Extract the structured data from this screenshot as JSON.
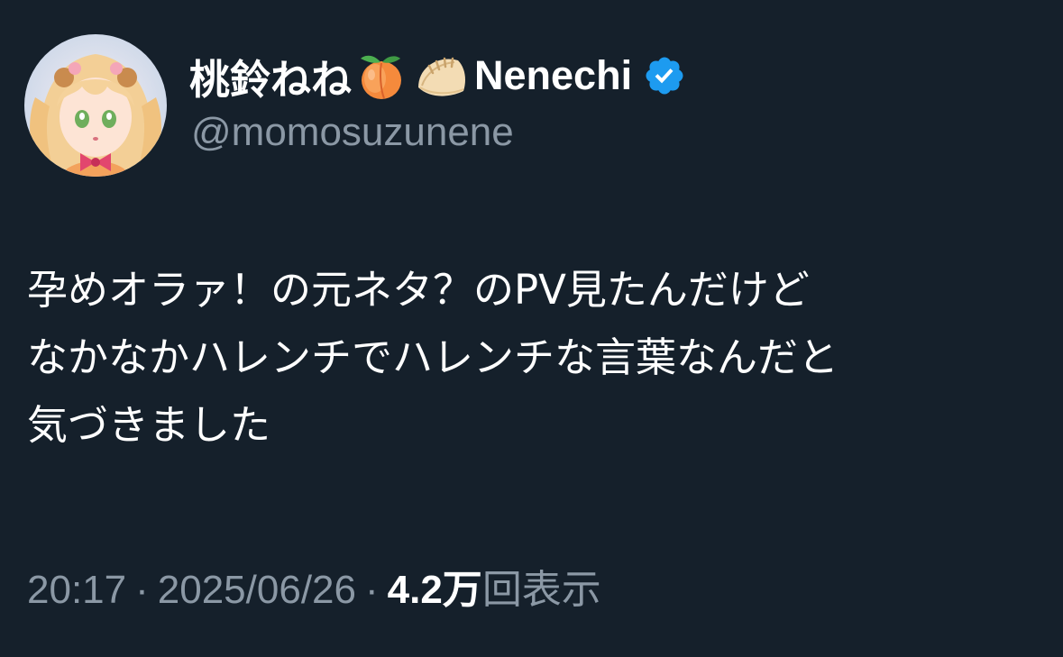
{
  "tweet": {
    "author": {
      "display_name": "桃鈴ねね",
      "name_emojis": [
        "peach-emoji",
        "dumpling-emoji"
      ],
      "name_suffix": "Nenechi",
      "verified": true,
      "handle": "@momosuzunene",
      "avatar_icon": "avatar"
    },
    "text_lines": [
      "孕めオラァ！の元ネタ？のPV見たんだけど",
      "なかなかハレンチでハレンチな言葉なんだと",
      "気づきました"
    ],
    "meta": {
      "time": "20:17",
      "separator": "·",
      "date": "2025/06/26",
      "views_count": "4.2万",
      "views_label": "回表示"
    }
  },
  "colors": {
    "background": "#15202b",
    "text_primary": "#ffffff",
    "text_secondary": "#8b98a5",
    "verified_badge": "#1d9bf0"
  }
}
